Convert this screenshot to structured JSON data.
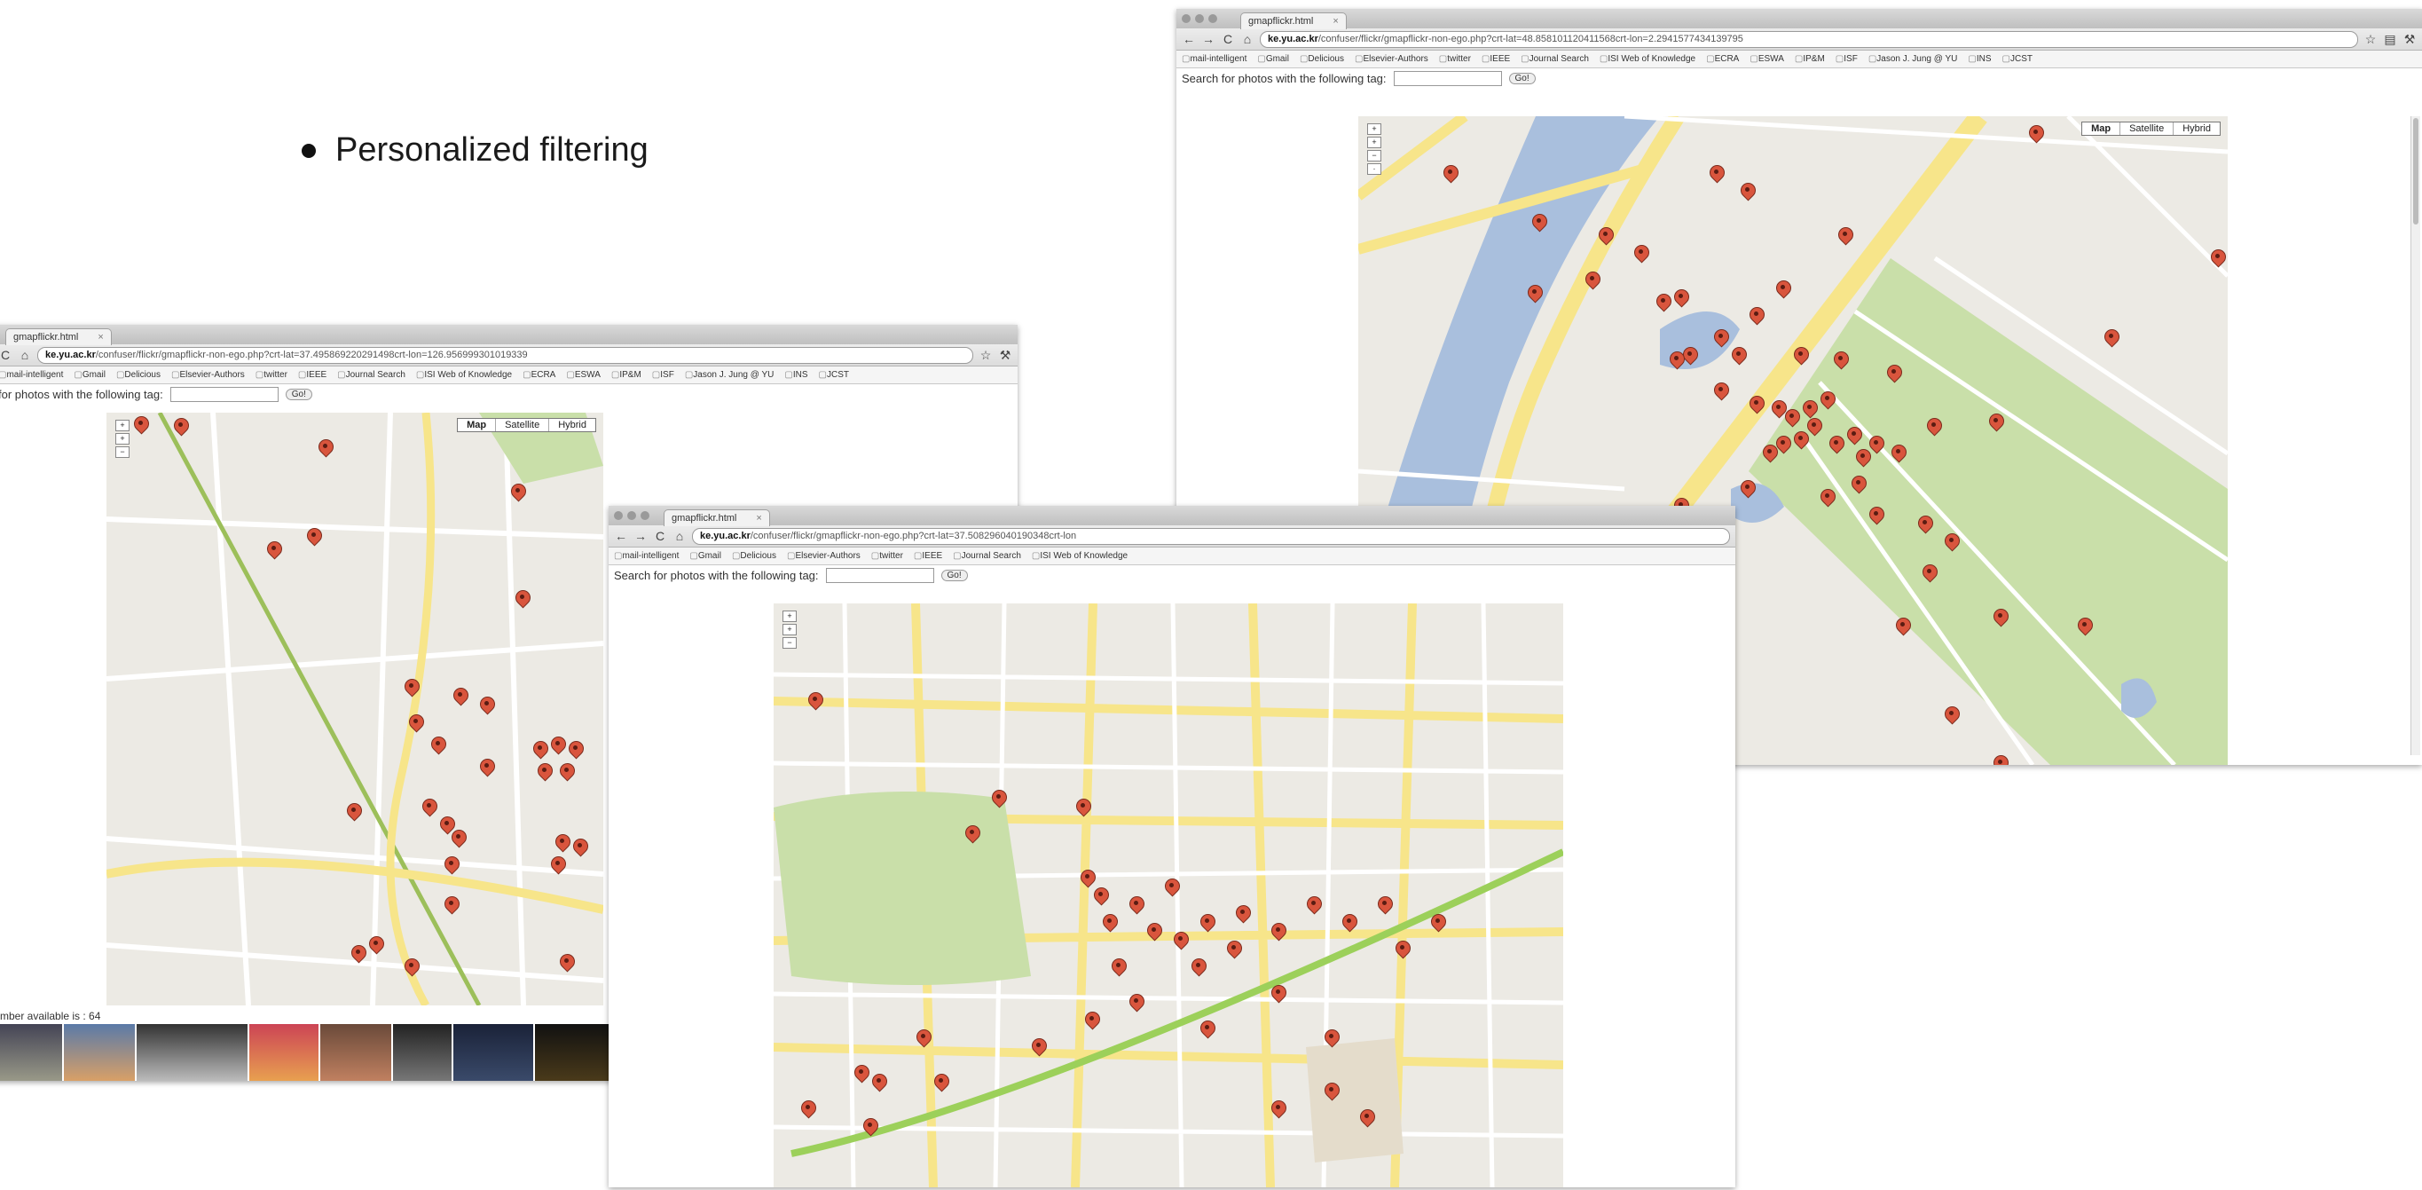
{
  "slide": {
    "bullet": "Personalized filtering"
  },
  "browser": {
    "tab_title": "gmapflickr.html",
    "bookmarks": [
      "mail-intelligent",
      "Gmail",
      "Delicious",
      "Elsevier-Authors",
      "twitter",
      "IEEE",
      "Journal Search",
      "ISI Web of Knowledge",
      "ECRA",
      "ESWA",
      "IP&M",
      "ISF",
      "Jason J. Jung @ YU",
      "INS",
      "JCST"
    ],
    "search_label": "Search for photos with the following tag:",
    "go_label": "Go!",
    "map_types": [
      "Map",
      "Satellite",
      "Hybrid"
    ]
  },
  "windows": {
    "left": {
      "url_host": "ke.yu.ac.kr",
      "url_path": "/confuser/flickr/gmapflickr-non-ego.php?crt-lat=37.495869220291498crt-lon=126.956999301019339",
      "search_label": "for photos with the following tag:",
      "number_text": "mber available is : 64"
    },
    "middle": {
      "url_host": "ke.yu.ac.kr",
      "url_path": "/confuser/flickr/gmapflickr-non-ego.php?crt-lat=37.508296040190348crt-lon"
    },
    "right": {
      "url_host": "ke.yu.ac.kr",
      "url_path": "/confuser/flickr/gmapflickr-non-ego.php?crt-lat=48.858101120411568crt-lon=2.2941577434139795"
    }
  },
  "colors": {
    "marker": "#d9553d",
    "road": "#f7e58a",
    "water": "#a9bfdd",
    "park": "#c9dfa9",
    "land": "#eceae4"
  }
}
